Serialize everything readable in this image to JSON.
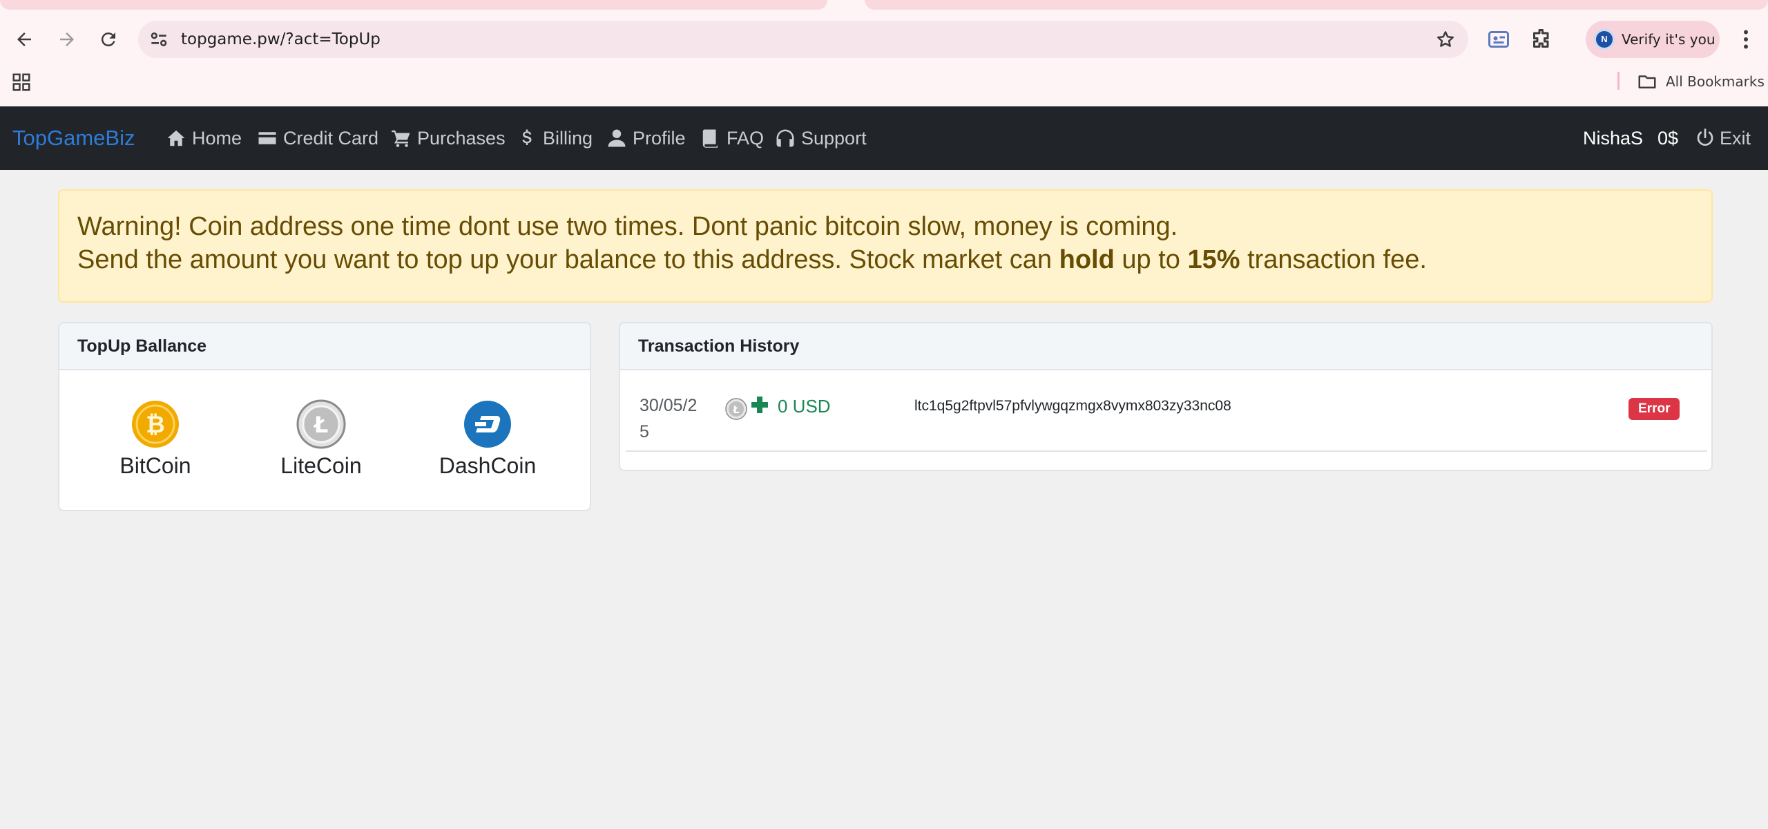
{
  "browser": {
    "url": "topgame.pw/?act=TopUp",
    "profile_button": "Verify it's you",
    "profile_initial": "N",
    "bookmarks_label": "All Bookmarks"
  },
  "navbar": {
    "brand": "TopGameBiz",
    "items": [
      {
        "label": "Home",
        "icon": "home-icon"
      },
      {
        "label": "Credit Card",
        "icon": "credit-card-icon"
      },
      {
        "label": "Purchases",
        "icon": "cart-icon"
      },
      {
        "label": "Billing",
        "icon": "dollar-icon"
      },
      {
        "label": "Profile",
        "icon": "user-icon"
      },
      {
        "label": "FAQ",
        "icon": "book-icon"
      },
      {
        "label": "Support",
        "icon": "headset-icon"
      }
    ],
    "username": "NishaS",
    "balance": "0$",
    "exit": "Exit"
  },
  "alert": {
    "line1": "Warning! Coin address one time dont use two times. Dont panic bitcoin slow, money is coming.",
    "line2_a": "Send the amount you want to top up your balance to this address. Stock market can ",
    "line2_hold": "hold",
    "line2_b": " up to ",
    "line2_pct": "15%",
    "line2_c": " transaction fee."
  },
  "topup": {
    "title": "TopUp Ballance",
    "coins": [
      {
        "label": "BitCoin",
        "icon": "bitcoin-icon",
        "color": "#f2a900"
      },
      {
        "label": "LiteCoin",
        "icon": "litecoin-icon",
        "color": "#bfbfbf"
      },
      {
        "label": "DashCoin",
        "icon": "dash-icon",
        "color": "#1c75bc"
      }
    ]
  },
  "history": {
    "title": "Transaction History",
    "rows": [
      {
        "date": "30/05/25",
        "coin_icon": "litecoin-icon",
        "amount": "0 USD",
        "address": "ltc1q5g2ftpvl57pfvlywgqzmgx8vymx803zy33nc08",
        "status": "Error"
      }
    ]
  },
  "colors": {
    "navbar_bg": "#212529",
    "brand": "#2f7bd8",
    "alert_bg": "#fff3cd",
    "alert_text": "#664d03",
    "success": "#198754",
    "danger": "#dc3545"
  }
}
